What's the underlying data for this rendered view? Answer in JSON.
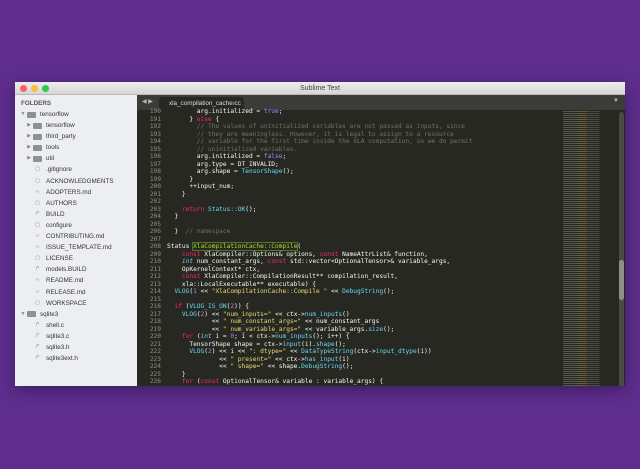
{
  "window": {
    "title": "Sublime Text",
    "colors": {
      "background": "#272822",
      "keyword": "#f92672",
      "string": "#e6db74",
      "function": "#66d9ef",
      "constant": "#ae81ff",
      "comment": "#75715e",
      "class": "#a6e22e"
    }
  },
  "sidebar": {
    "header": "FOLDERS",
    "items": [
      {
        "label": "tensorflow",
        "type": "folder-open",
        "depth": 0
      },
      {
        "label": "tensorflow",
        "type": "folder",
        "depth": 1
      },
      {
        "label": "third_party",
        "type": "folder",
        "depth": 1
      },
      {
        "label": "tools",
        "type": "folder",
        "depth": 1
      },
      {
        "label": "util",
        "type": "folder",
        "depth": 1
      },
      {
        "label": ".gitignore",
        "type": "file",
        "depth": 1
      },
      {
        "label": "ACKNOWLEDGMENTS",
        "type": "file",
        "depth": 1
      },
      {
        "label": "ADOPTERS.md",
        "type": "markup",
        "depth": 1
      },
      {
        "label": "AUTHORS",
        "type": "file",
        "depth": 1
      },
      {
        "label": "BUILD",
        "type": "code",
        "depth": 1
      },
      {
        "label": "configure",
        "type": "file",
        "depth": 1
      },
      {
        "label": "CONTRIBUTING.md",
        "type": "markup",
        "depth": 1
      },
      {
        "label": "ISSUE_TEMPLATE.md",
        "type": "markup",
        "depth": 1
      },
      {
        "label": "LICENSE",
        "type": "file",
        "depth": 1
      },
      {
        "label": "models.BUILD",
        "type": "code",
        "depth": 1
      },
      {
        "label": "README.md",
        "type": "markup",
        "depth": 1
      },
      {
        "label": "RELEASE.md",
        "type": "markup",
        "depth": 1
      },
      {
        "label": "WORKSPACE",
        "type": "file",
        "depth": 1
      },
      {
        "label": "sqlite3",
        "type": "folder-open",
        "depth": 0
      },
      {
        "label": "shell.c",
        "type": "code",
        "depth": 1
      },
      {
        "label": "sqlite3.c",
        "type": "code",
        "depth": 1
      },
      {
        "label": "sqlite3.h",
        "type": "code",
        "depth": 1
      },
      {
        "label": "sqlite3ext.h",
        "type": "code",
        "depth": 1
      }
    ]
  },
  "tabs": [
    {
      "label": "xla_compilation_cache.cc",
      "close": "×",
      "active": true
    }
  ],
  "nav": {
    "back": "◀",
    "forward": "▶",
    "menu": "▼"
  },
  "editor": {
    "lines": [
      {
        "n": "190",
        "t": [
          [
            "",
            "        arg.initialized = "
          ],
          [
            "p",
            "true"
          ],
          [
            "",
            ";"
          ]
        ]
      },
      {
        "n": "191",
        "t": [
          [
            "",
            "      } "
          ],
          [
            "k",
            "else"
          ],
          [
            "",
            " {"
          ]
        ]
      },
      {
        "n": "192",
        "t": [
          [
            "c",
            "        // The values of uninitialized variables are not passed as inputs, since"
          ]
        ]
      },
      {
        "n": "193",
        "t": [
          [
            "c",
            "        // they are meaningless. However, it is legal to assign to a resource"
          ]
        ]
      },
      {
        "n": "194",
        "t": [
          [
            "c",
            "        // variable for the first time inside the XLA computation, so we do permit"
          ]
        ]
      },
      {
        "n": "195",
        "t": [
          [
            "c",
            "        // uninitialized variables."
          ]
        ]
      },
      {
        "n": "196",
        "t": [
          [
            "",
            "        arg.initialized = "
          ],
          [
            "p",
            "false"
          ],
          [
            "",
            ";"
          ]
        ]
      },
      {
        "n": "197",
        "t": [
          [
            "",
            "        arg.type = DT_INVALID;"
          ]
        ]
      },
      {
        "n": "198",
        "t": [
          [
            "",
            "        arg.shape = "
          ],
          [
            "f",
            "TensorShape"
          ],
          [
            "",
            "();"
          ]
        ]
      },
      {
        "n": "199",
        "t": [
          [
            "",
            "      }"
          ]
        ]
      },
      {
        "n": "200",
        "t": [
          [
            "",
            "      ++input_num;"
          ]
        ]
      },
      {
        "n": "201",
        "t": [
          [
            "",
            "    }"
          ]
        ]
      },
      {
        "n": "202",
        "t": [
          [
            "",
            ""
          ]
        ]
      },
      {
        "n": "203",
        "t": [
          [
            "",
            "    "
          ],
          [
            "k",
            "return"
          ],
          [
            "",
            " "
          ],
          [
            "f",
            "Status::OK"
          ],
          [
            "",
            "();"
          ]
        ]
      },
      {
        "n": "204",
        "t": [
          [
            "",
            "  }"
          ]
        ]
      },
      {
        "n": "205",
        "t": [
          [
            "",
            ""
          ]
        ]
      },
      {
        "n": "206",
        "t": [
          [
            "",
            "  }  "
          ],
          [
            "c",
            "// namespace"
          ]
        ]
      },
      {
        "n": "207",
        "t": [
          [
            "",
            ""
          ]
        ]
      },
      {
        "n": "208",
        "t": [
          [
            "",
            "Status "
          ],
          [
            "g",
            "XlaCompilationCache::Compile"
          ],
          [
            "",
            "("
          ]
        ]
      },
      {
        "n": "209",
        "t": [
          [
            "",
            "    "
          ],
          [
            "k",
            "const"
          ],
          [
            "",
            " XlaCompiler::Options& options, "
          ],
          [
            "k",
            "const"
          ],
          [
            "",
            " NameAttrList& function,"
          ]
        ]
      },
      {
        "n": "210",
        "t": [
          [
            "",
            "    "
          ],
          [
            "t",
            "int"
          ],
          [
            "",
            " num_constant_args, "
          ],
          [
            "k",
            "const"
          ],
          [
            "",
            " std::vector<OptionalTensor>& variable_args,"
          ]
        ]
      },
      {
        "n": "211",
        "t": [
          [
            "",
            "    OpKernelContext* ctx,"
          ]
        ]
      },
      {
        "n": "212",
        "t": [
          [
            "",
            "    "
          ],
          [
            "k",
            "const"
          ],
          [
            "",
            " XlaCompiler::CompilationResult** compilation_result,"
          ]
        ]
      },
      {
        "n": "213",
        "t": [
          [
            "",
            "    xla::LocalExecutable** executable) {"
          ]
        ]
      },
      {
        "n": "214",
        "t": [
          [
            "",
            "  "
          ],
          [
            "f",
            "VLOG"
          ],
          [
            "",
            "("
          ],
          [
            "p",
            "1"
          ],
          [
            "",
            " << "
          ],
          [
            "s",
            "\"XlaCompilationCache::Compile \""
          ],
          [
            "",
            " << "
          ],
          [
            "f",
            "DebugString"
          ],
          [
            "",
            "();"
          ]
        ]
      },
      {
        "n": "215",
        "t": [
          [
            "",
            ""
          ]
        ]
      },
      {
        "n": "216",
        "t": [
          [
            "",
            "  "
          ],
          [
            "k",
            "if"
          ],
          [
            "",
            " ("
          ],
          [
            "f",
            "VLOG_IS_ON"
          ],
          [
            "",
            "("
          ],
          [
            "p",
            "2"
          ],
          [
            "",
            ")) {"
          ]
        ]
      },
      {
        "n": "217",
        "t": [
          [
            "",
            "    "
          ],
          [
            "f",
            "VLOG"
          ],
          [
            "",
            "("
          ],
          [
            "p",
            "2"
          ],
          [
            "",
            ") << "
          ],
          [
            "s",
            "\"num_inputs=\""
          ],
          [
            "",
            " << ctx->"
          ],
          [
            "f",
            "num_inputs"
          ],
          [
            "",
            "()"
          ]
        ]
      },
      {
        "n": "218",
        "t": [
          [
            "",
            "            << "
          ],
          [
            "s",
            "\" num_constant_args=\""
          ],
          [
            "",
            " << num_constant_args"
          ]
        ]
      },
      {
        "n": "219",
        "t": [
          [
            "",
            "            << "
          ],
          [
            "s",
            "\" num_variable_args=\""
          ],
          [
            "",
            " << variable_args."
          ],
          [
            "f",
            "size"
          ],
          [
            "",
            "();"
          ]
        ]
      },
      {
        "n": "220",
        "t": [
          [
            "",
            "    "
          ],
          [
            "k",
            "for"
          ],
          [
            "",
            " ("
          ],
          [
            "t",
            "int"
          ],
          [
            "",
            " i = "
          ],
          [
            "p",
            "0"
          ],
          [
            "",
            "; i < ctx->"
          ],
          [
            "f",
            "num_inputs"
          ],
          [
            "",
            "(); i++) {"
          ]
        ]
      },
      {
        "n": "221",
        "t": [
          [
            "",
            "      TensorShape shape = ctx->"
          ],
          [
            "f",
            "input"
          ],
          [
            "",
            "(i)."
          ],
          [
            "f",
            "shape"
          ],
          [
            "",
            "();"
          ]
        ]
      },
      {
        "n": "222",
        "t": [
          [
            "",
            "      "
          ],
          [
            "f",
            "VLOG"
          ],
          [
            "",
            "("
          ],
          [
            "p",
            "2"
          ],
          [
            "",
            ") << i << "
          ],
          [
            "s",
            "\": dtype=\""
          ],
          [
            "",
            " << "
          ],
          [
            "f",
            "DataTypeString"
          ],
          [
            "",
            "(ctx->"
          ],
          [
            "f",
            "input_dtype"
          ],
          [
            "",
            "(i))"
          ]
        ]
      },
      {
        "n": "223",
        "t": [
          [
            "",
            "              << "
          ],
          [
            "s",
            "\" present=\""
          ],
          [
            "",
            " << ctx->"
          ],
          [
            "f",
            "has_input"
          ],
          [
            "",
            "(i)"
          ]
        ]
      },
      {
        "n": "224",
        "t": [
          [
            "",
            "              << "
          ],
          [
            "s",
            "\" shape=\""
          ],
          [
            "",
            " << shape."
          ],
          [
            "f",
            "DebugString"
          ],
          [
            "",
            "();"
          ]
        ]
      },
      {
        "n": "225",
        "t": [
          [
            "",
            "    }"
          ]
        ]
      },
      {
        "n": "226",
        "t": [
          [
            "",
            "    "
          ],
          [
            "k",
            "for"
          ],
          [
            "",
            " ("
          ],
          [
            "k",
            "const"
          ],
          [
            "",
            " OptionalTensor& variable : variable_args) {"
          ]
        ]
      }
    ]
  }
}
